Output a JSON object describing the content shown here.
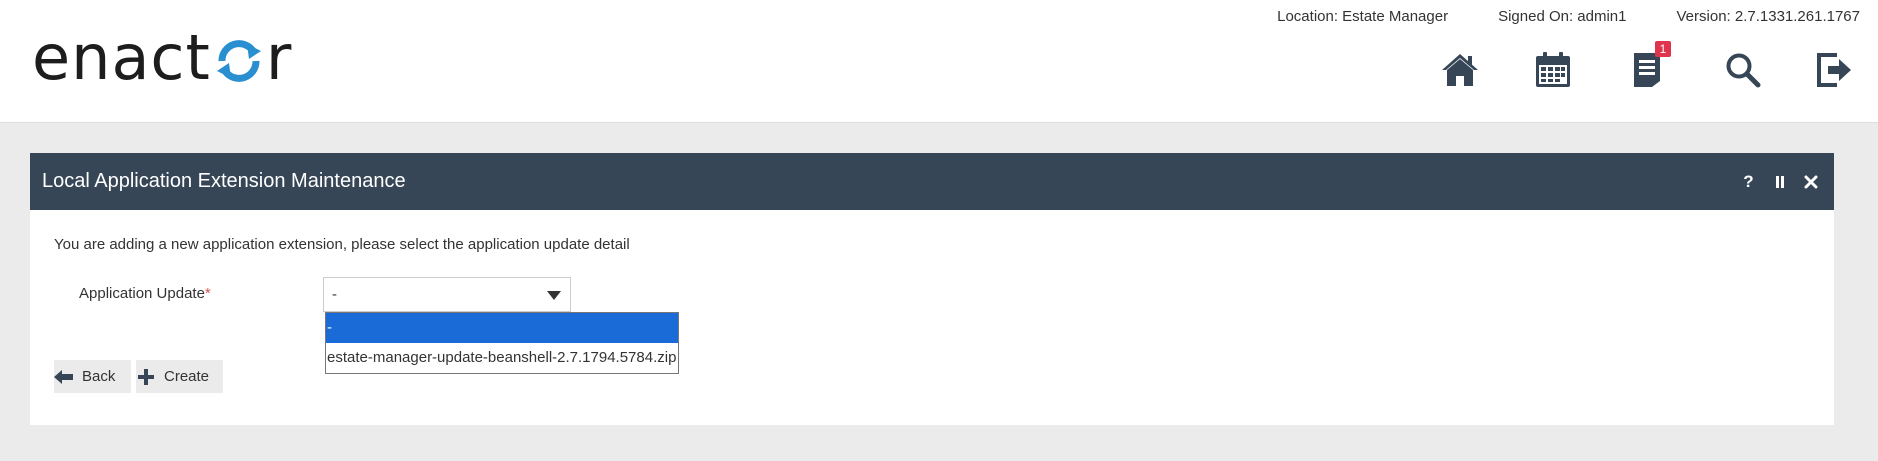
{
  "header": {
    "logo_text_a": "enact",
    "logo_text_b": "r",
    "location": "Location: Estate Manager",
    "signed_on": "Signed On: admin1",
    "version": "Version: 2.7.1331.261.1767",
    "icons": [
      "home-icon",
      "calendar-icon",
      "document-icon",
      "search-icon",
      "logout-icon"
    ],
    "notification_count": "1"
  },
  "panel": {
    "title": "Local Application Extension Maintenance",
    "help": "?",
    "intro": "You are adding a new application extension, please select the application update detail",
    "field_label": "Application Update",
    "required_mark": "*",
    "select_value": "-",
    "options": [
      "-",
      "estate-manager-update-beanshell-2.7.1794.5784.zip"
    ],
    "selected_index": 0,
    "back_label": "Back",
    "create_label": "Create"
  },
  "colors": {
    "title_bar": "#374657",
    "accent_blue": "#1a6ad8",
    "logo_ring": "#2a8fd0",
    "badge": "#e0344d"
  }
}
